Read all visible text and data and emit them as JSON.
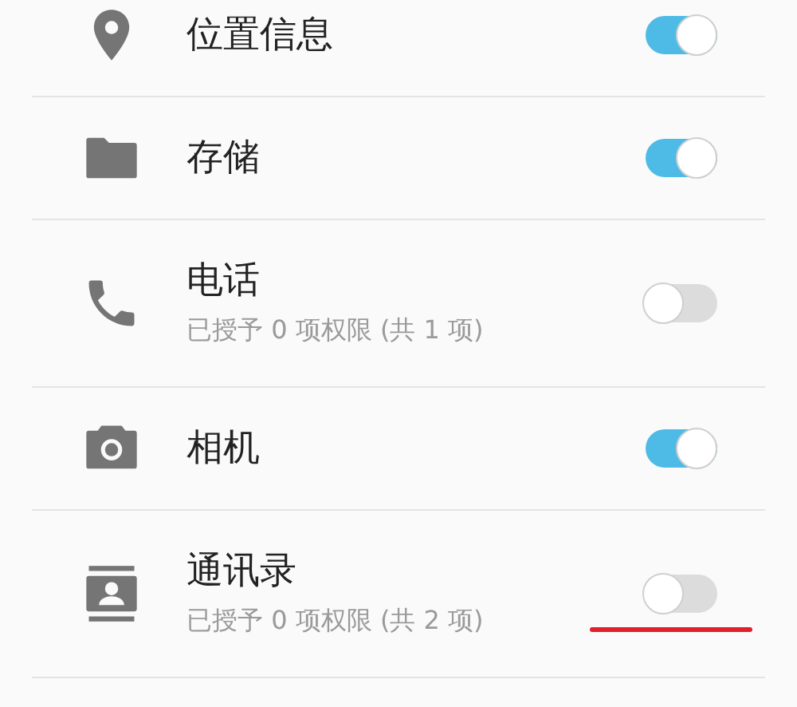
{
  "permissions": [
    {
      "kind": "location",
      "title": "位置信息",
      "on": true,
      "underlined": false
    },
    {
      "kind": "folder",
      "title": "存储",
      "on": true,
      "underlined": false
    },
    {
      "kind": "phone",
      "title": "电话",
      "subtitle": "已授予 0 项权限 (共 1 项)",
      "on": false,
      "underlined": false
    },
    {
      "kind": "camera",
      "title": "相机",
      "on": true,
      "underlined": false
    },
    {
      "kind": "contacts",
      "title": "通讯录",
      "subtitle": "已授予 0 项权限 (共 2 项)",
      "on": false,
      "underlined": true
    }
  ]
}
